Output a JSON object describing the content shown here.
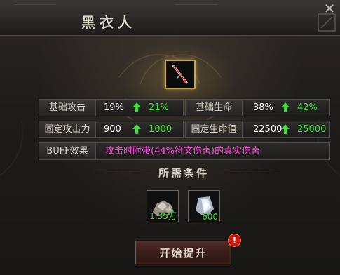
{
  "window": {
    "title": "黑衣人"
  },
  "stats": {
    "base_attack": {
      "label": "基础攻击",
      "current": "19%",
      "next": "21%"
    },
    "base_health": {
      "label": "基础生命",
      "current": "38%",
      "next": "42%"
    },
    "fixed_attack": {
      "label": "固定攻击力",
      "current": "900",
      "next": "1000"
    },
    "fixed_health": {
      "label": "固定生命值",
      "current": "22500",
      "next": "25000"
    }
  },
  "buff": {
    "label": "BUFF效果",
    "text": "攻击时附带(44%符文伤害)的真实伤害"
  },
  "requirements": {
    "title": "所需条件",
    "items": [
      {
        "icon": "silver-ore-icon",
        "count": "1.35万"
      },
      {
        "icon": "crystal-icon",
        "count": "600"
      }
    ]
  },
  "actions": {
    "upgrade_label": "开始提升",
    "alert_glyph": "!"
  },
  "colors": {
    "gain": "#3ee03e",
    "buff": "#ff44dd",
    "frame_gold": "#c9a44e"
  }
}
